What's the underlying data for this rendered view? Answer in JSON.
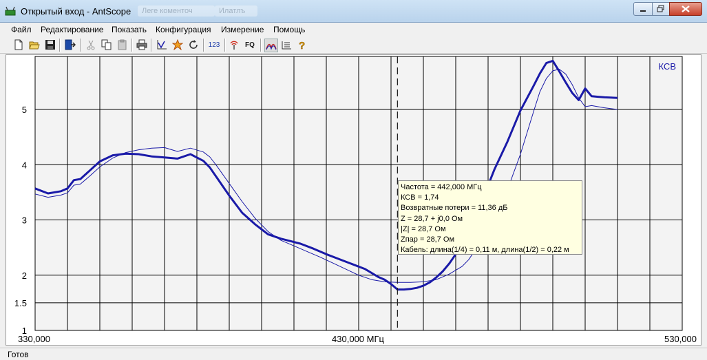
{
  "window": {
    "title": "Открытый вход - AntScope",
    "ghost_tabs": [
      "Леге коменточ",
      "Илатлъ"
    ]
  },
  "menu": [
    "Файл",
    "Редактирование",
    "Показать",
    "Конфигурация",
    "Измерение",
    "Помощь"
  ],
  "toolbar": {
    "icons": [
      "new-file-icon",
      "open-folder-icon",
      "save-icon",
      "export-icon",
      "cut-icon",
      "copy-icon",
      "paste-icon",
      "print-icon",
      "graph-icon",
      "star-icon",
      "refresh-icon",
      "numbers-icon",
      "antenna-icon",
      "fq-icon",
      "curves-icon",
      "list-icon",
      "help-icon"
    ],
    "numbers_label": "123",
    "fq_label": "FQ"
  },
  "chart_data": {
    "type": "line",
    "title": "КСВ",
    "xlim": [
      330,
      530
    ],
    "ylim": [
      1,
      5.96
    ],
    "x_ticks": [
      "330,000",
      "430,000 МГц",
      "530,000"
    ],
    "y_ticks": [
      {
        "value": 1,
        "label": "1"
      },
      {
        "value": 1.5,
        "label": "1.5"
      },
      {
        "value": 2,
        "label": "2"
      },
      {
        "value": 3,
        "label": "3"
      },
      {
        "value": 4,
        "label": "4"
      },
      {
        "value": 5,
        "label": "5"
      }
    ],
    "grid": true,
    "cursor_x": 442,
    "series": [
      {
        "style": "thick",
        "color": "#1a1aa8",
        "x": [
          330,
          334,
          338,
          340,
          342,
          344,
          347,
          350,
          354,
          358,
          362,
          366,
          370,
          374,
          378,
          382,
          384,
          386,
          390,
          394,
          398,
          402,
          406,
          408,
          412,
          416,
          420,
          424,
          428,
          432,
          434,
          436,
          438,
          440,
          442,
          444,
          446,
          448,
          450,
          452,
          454,
          456,
          458,
          460,
          462,
          464,
          468,
          472,
          476,
          480,
          484,
          486,
          488,
          490,
          492,
          494,
          496,
          498,
          500,
          502,
          504,
          506,
          510
        ],
        "y": [
          3.57,
          3.48,
          3.52,
          3.57,
          3.72,
          3.74,
          3.9,
          4.06,
          4.17,
          4.2,
          4.19,
          4.15,
          4.13,
          4.11,
          4.19,
          4.07,
          3.95,
          3.78,
          3.44,
          3.13,
          2.92,
          2.74,
          2.66,
          2.63,
          2.57,
          2.48,
          2.38,
          2.29,
          2.2,
          2.11,
          2.04,
          1.97,
          1.92,
          1.84,
          1.74,
          1.74,
          1.75,
          1.77,
          1.81,
          1.87,
          1.96,
          2.07,
          2.21,
          2.38,
          2.58,
          2.82,
          3.33,
          3.92,
          4.42,
          4.98,
          5.42,
          5.65,
          5.84,
          5.88,
          5.69,
          5.49,
          5.3,
          5.17,
          5.38,
          5.24,
          5.23,
          5.22,
          5.21
        ]
      },
      {
        "style": "thin",
        "color": "#1a1aa8",
        "x": [
          330,
          334,
          338,
          340,
          342,
          344,
          347,
          350,
          354,
          358,
          362,
          366,
          370,
          374,
          378,
          382,
          384,
          386,
          390,
          394,
          398,
          402,
          406,
          410,
          414,
          418,
          422,
          426,
          430,
          434,
          438,
          442,
          446,
          450,
          454,
          458,
          462,
          464,
          468,
          472,
          476,
          480,
          484,
          486,
          488,
          490,
          492,
          494,
          496,
          498,
          500,
          502,
          504,
          506,
          510
        ],
        "y": [
          3.47,
          3.41,
          3.45,
          3.49,
          3.63,
          3.65,
          3.8,
          3.96,
          4.12,
          4.22,
          4.27,
          4.3,
          4.31,
          4.24,
          4.3,
          4.23,
          4.14,
          3.99,
          3.66,
          3.33,
          3.03,
          2.79,
          2.63,
          2.53,
          2.43,
          2.33,
          2.22,
          2.11,
          2.0,
          1.92,
          1.88,
          1.87,
          1.87,
          1.88,
          1.92,
          2.02,
          2.16,
          2.28,
          2.63,
          3.05,
          3.55,
          4.19,
          4.95,
          5.32,
          5.56,
          5.7,
          5.73,
          5.64,
          5.45,
          5.21,
          5.05,
          5.07,
          5.05,
          5.03,
          5.0
        ]
      }
    ]
  },
  "tooltip": {
    "lines": [
      "Частота = 442,000 МГц",
      "КСВ = 1,74",
      "Возвратные потери = 11,36 дБ",
      "Z = 28,7 + j0,0 Ом",
      "|Z| = 28,7 Ом",
      "Zпар = 28,7 Ом",
      "Кабель: длина(1/4) = 0,11 м, длина(1/2) = 0,22 м"
    ]
  },
  "status": {
    "text": "Готов"
  }
}
